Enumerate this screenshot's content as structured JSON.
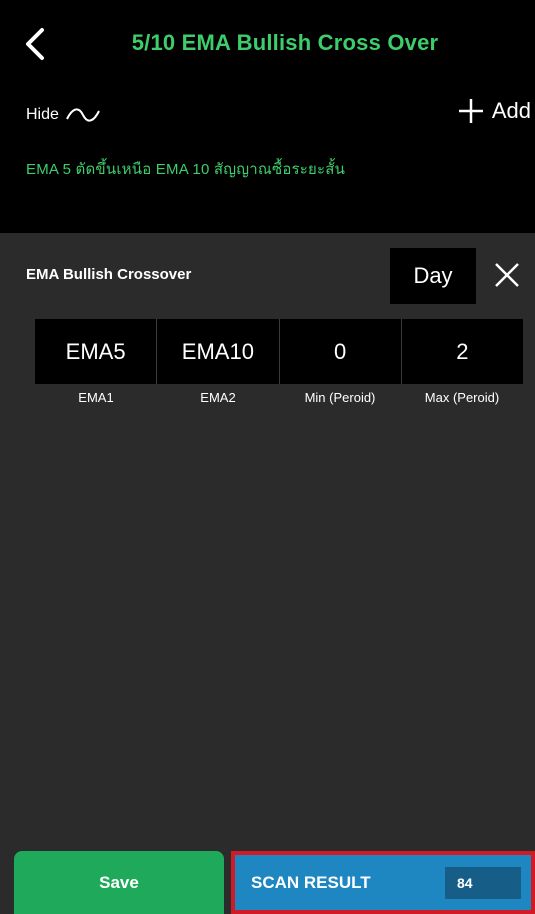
{
  "header": {
    "title": "5/10 EMA Bullish Cross Over",
    "hide_label": "Hide",
    "add_label": "Add",
    "description": "EMA 5 ตัดขึ้นเหนือ EMA 10 สัญญาณซื้อระยะสั้น"
  },
  "condition": {
    "title": "EMA Bullish Crossover",
    "period": "Day",
    "params": [
      {
        "value": "EMA5",
        "label": "EMA1"
      },
      {
        "value": "EMA10",
        "label": "EMA2"
      },
      {
        "value": "0",
        "label": "Min (Peroid)"
      },
      {
        "value": "2",
        "label": "Max (Peroid)"
      }
    ]
  },
  "footer": {
    "save_label": "Save",
    "scan_label": "SCAN RESULT",
    "scan_count": "84"
  },
  "colors": {
    "accent_green": "#3dcd6b",
    "save_green": "#1faa5b",
    "scan_blue": "#1e86c0",
    "highlight_red": "#d21a27"
  },
  "icons": {
    "back": "chevron-left-icon",
    "hide": "wave-icon",
    "add": "plus-icon",
    "close": "close-icon"
  }
}
